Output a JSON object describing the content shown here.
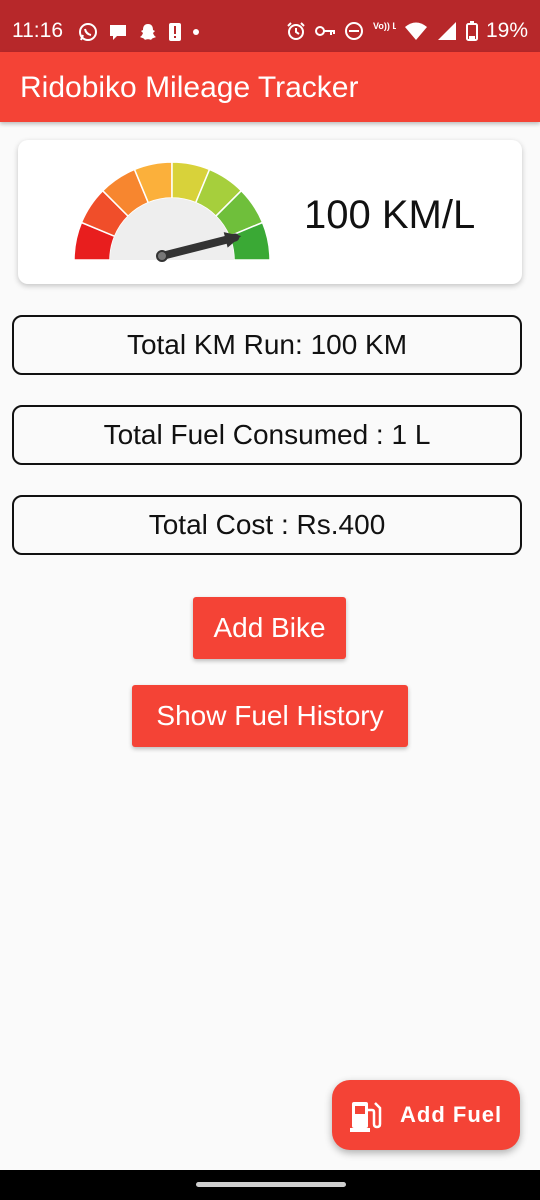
{
  "status_bar": {
    "time": "11:16",
    "battery": "19%",
    "left_icons": [
      "whatsapp-icon",
      "chat-icon",
      "snapchat-icon",
      "alert-icon",
      "dot-icon"
    ],
    "right_icons": [
      "alarm-icon",
      "key-icon",
      "dnd-icon",
      "volte-icon",
      "wifi-icon",
      "signal-icon",
      "battery-icon"
    ],
    "volte_label": "Vo)) LTE"
  },
  "app_bar": {
    "title": "Ridobiko Mileage Tracker"
  },
  "gauge": {
    "mileage": "100 KM/L",
    "needle_level": 0.93,
    "colors": [
      "#e81e1e",
      "#f04e2a",
      "#f7862f",
      "#fbb03b",
      "#d8d23a",
      "#a6cf3c",
      "#6fbf3b",
      "#3aa935"
    ]
  },
  "stats": {
    "total_km": "Total KM Run: 100 KM",
    "total_fuel": "Total Fuel Consumed : 1 L",
    "total_cost": "Total Cost : Rs.400"
  },
  "buttons": {
    "add_bike": "Add Bike",
    "show_history": "Show Fuel History"
  },
  "fab": {
    "label": "Add Fuel",
    "icon": "fuel-pump-icon"
  },
  "colors": {
    "accent": "#f44336",
    "status_bar": "#b7282a"
  }
}
